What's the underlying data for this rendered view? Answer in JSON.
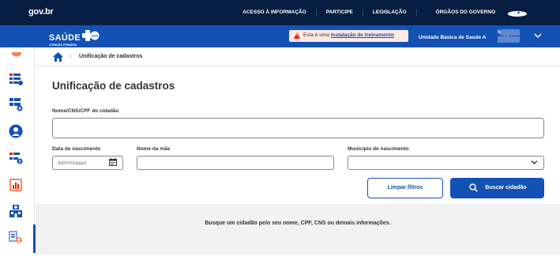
{
  "govbar": {
    "logo": "gov.br",
    "links": [
      "ACESSO À INFORMAÇÃO",
      "PARTICIPE",
      "LEGISLAÇÃO",
      "ÓRGÃOS DO GOVERNO"
    ]
  },
  "app": {
    "brand_name": "SAÚDE",
    "brand_sub": "ATENÇÃO PRIMÁRIA",
    "brand_badge": "SUS",
    "warning_prefix": "Esta é uma",
    "warning_link": "Instalação de treinamento",
    "user_line1": "Ig",
    "user_line2": "Unidade Basica de Saude A",
    "user_line2_tail": "ca"
  },
  "breadcrumb": {
    "page": "Unificação de cadastros"
  },
  "page": {
    "title": "Unificação de cadastros",
    "label_search": "Nome/CNS/CPF do cidadão",
    "label_birth": "Data de nascimento",
    "birth_placeholder": "dd/mm/aaaa",
    "label_mother": "Nome da mãe",
    "label_city": "Município de nascimento",
    "btn_clear": "Limpar filtros",
    "btn_search": "Buscar cidadão",
    "empty_message": "Busque um cidadão pelo seu nome, CPF, CNS ou demais informações."
  },
  "colors": {
    "gov_dark": "#071d41",
    "primary": "#1351b4",
    "warning_bg": "#fde8e2",
    "warning_icon": "#e52207",
    "results_bg": "#f2f2f3"
  },
  "sidebar_icons": [
    "bookmark-icon",
    "list-check-icon",
    "list-add-icon",
    "health-user-icon",
    "list-arrow-icon",
    "bar-chart-icon",
    "hospital-icon",
    "document-user-icon"
  ]
}
